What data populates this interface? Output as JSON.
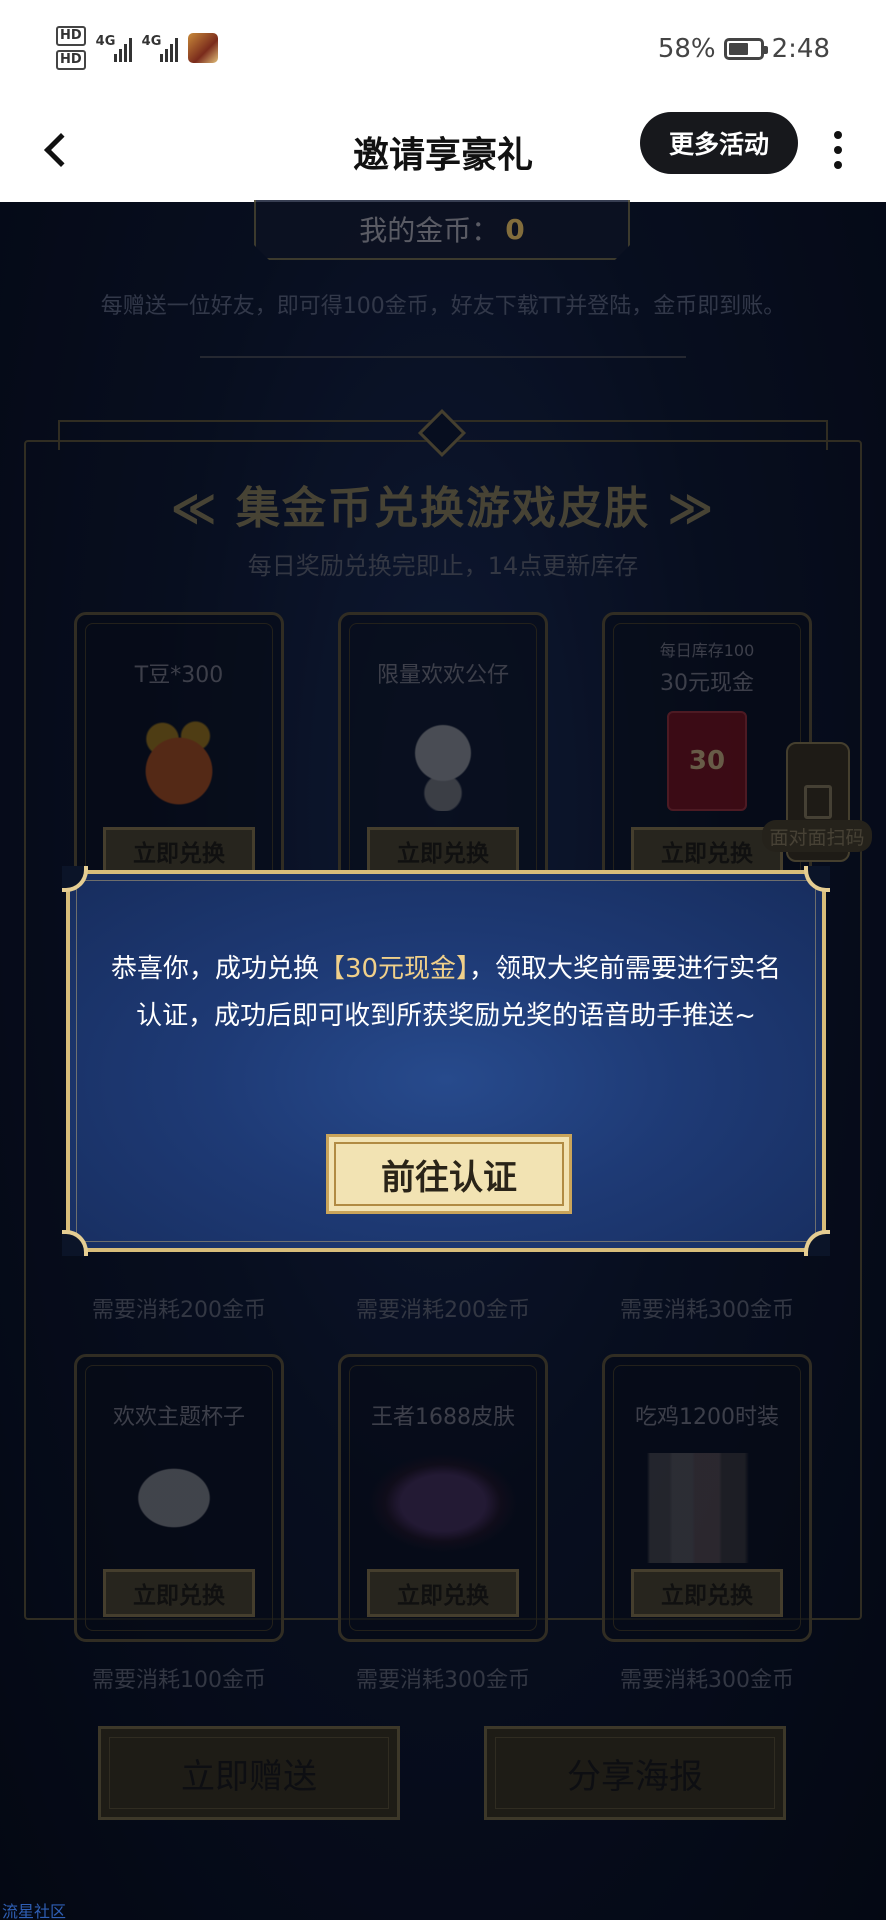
{
  "status_bar": {
    "hd1": "HD",
    "hd2": "HD",
    "net1": "4G",
    "net2": "4G",
    "battery_pct": "58%",
    "time": "2:48",
    "battery_level": 0.58
  },
  "nav": {
    "title": "邀请享豪礼",
    "more_label": "更多活动",
    "back_icon": "chevron-left-icon",
    "menu_icon": "more-vertical-icon"
  },
  "coins": {
    "label": "我的金币：",
    "value": "0"
  },
  "invite_desc": "每赠送一位好友，即可得100金币，好友下载TT并登陆，金币即到账。",
  "section": {
    "title": "≪ 集金币兑换游戏皮肤 ≫",
    "subtitle": "每日奖励兑换完即止，14点更新库存"
  },
  "cards": [
    {
      "name": "T豆*300",
      "stock": "",
      "button": "立即兑换"
    },
    {
      "name": "限量欢欢公仔",
      "stock": "",
      "button": "立即兑换"
    },
    {
      "name": "30元现金",
      "stock": "每日库存100",
      "button": "立即兑换",
      "badge": "30"
    },
    {
      "name": "欢欢主题杯子",
      "stock": "",
      "button": "立即兑换",
      "cost": "需要消耗100金币"
    },
    {
      "name": "王者1688皮肤",
      "stock": "",
      "button": "立即兑换",
      "cost": "需要消耗300金币"
    },
    {
      "name": "吃鸡1200时装",
      "stock": "",
      "button": "立即兑换",
      "cost": "需要消耗300金币"
    }
  ],
  "row2_costs": [
    "需要消耗200金币",
    "需要消耗200金币",
    "需要消耗300金币"
  ],
  "scan": {
    "label": "面对面扫码"
  },
  "bottom": {
    "gift_label": "立即赠送",
    "share_label": "分享海报"
  },
  "modal": {
    "text_before": "恭喜你，成功兑换",
    "highlight": "【30元现金】",
    "text_after": "，领取大奖前需要进行实名认证，成功后即可收到所获奖励兑奖的语音助手推送~",
    "confirm_label": "前往认证"
  },
  "watermark": "流星社区",
  "colors": {
    "accent_gold": "#d8bd7a",
    "modal_blue": "#1e3a75",
    "highlight": "#f0d08a"
  }
}
